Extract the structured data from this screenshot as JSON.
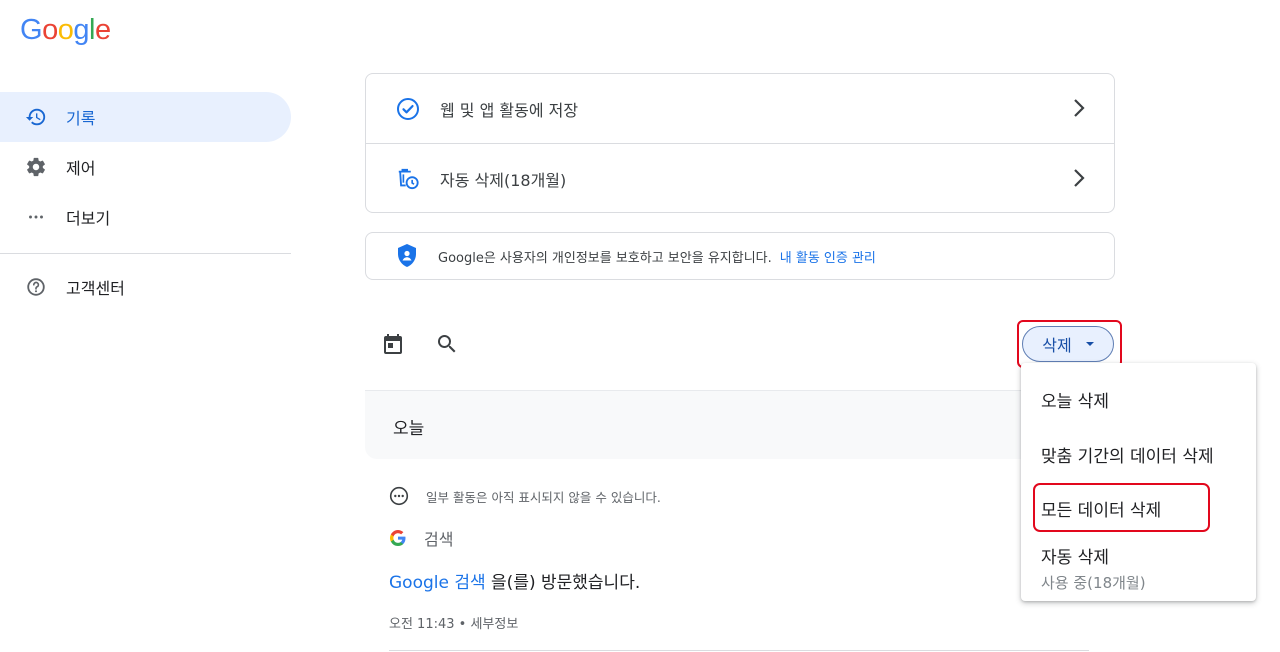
{
  "logo": {
    "letters": [
      "G",
      "o",
      "o",
      "g",
      "l",
      "e"
    ],
    "colors": [
      "#4285F4",
      "#EA4335",
      "#FBBC05",
      "#4285F4",
      "#34A853",
      "#EA4335"
    ]
  },
  "sidebar": {
    "items": [
      {
        "label": "기록",
        "icon": "history-icon"
      },
      {
        "label": "제어",
        "icon": "gear-icon"
      },
      {
        "label": "더보기",
        "icon": "more-horiz-icon"
      },
      {
        "label": "고객센터",
        "icon": "help-icon"
      }
    ]
  },
  "settings_card": {
    "web_app_activity": "웹 및 앱 활동에 저장",
    "auto_delete": "자동 삭제(18개월)"
  },
  "privacy": {
    "text": "Google은 사용자의 개인정보를 보호하고 보안을 유지합니다.",
    "link": "내 활동 인증 관리"
  },
  "toolbar": {
    "delete_label": "삭제"
  },
  "today_header": "오늘",
  "activity": {
    "note": "일부 활동은 아직 표시되지 않을 수 있습니다.",
    "source": "검색",
    "visit_link": "Google 검색",
    "visit_rest": " 을(를) 방문했습니다.",
    "meta": "오전 11:43 • 세부정보"
  },
  "delete_menu": {
    "items": [
      {
        "label": "오늘 삭제"
      },
      {
        "label": "맞춤 기간의 데이터 삭제"
      },
      {
        "label": "모든 데이터 삭제"
      },
      {
        "label": "자동 삭제",
        "sub": "사용 중(18개월)"
      }
    ]
  },
  "colors": {
    "accent": "#1a73e8",
    "highlight": "#e2081d",
    "active_bg": "#e8f0fe"
  }
}
